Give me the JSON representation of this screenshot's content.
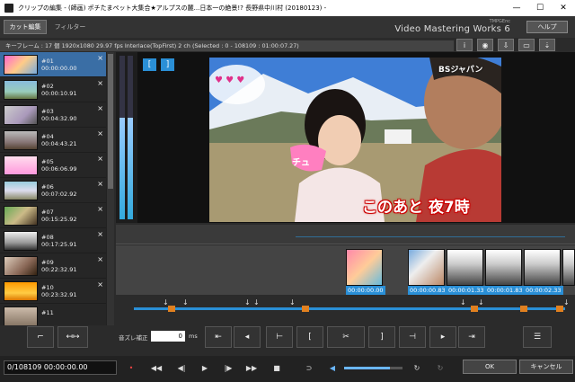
{
  "window": {
    "title": "クリップの編集 - (師画) ポチたまペット大集合★アルプスの麓...日本一の絶景!? 長野県中川村 (20180123) -",
    "minimize": "—",
    "maximize": "☐",
    "close": "✕"
  },
  "tabs": [
    {
      "label": "カット編集"
    },
    {
      "label": "フィルター"
    }
  ],
  "brand": {
    "small": "TMPGEnc",
    "name": "Video Mastering Works 6"
  },
  "help_label": "ヘルプ",
  "info_text": "キーフレーム : 17 個   1920x1080 29.97 fps  Interlace(TopFirst)  2 ch  (Selected : 0 - 108109 : 01:00:07.27)",
  "toolbar_icons": [
    {
      "name": "info-icon",
      "glyph": "i"
    },
    {
      "name": "audio-icon",
      "glyph": "◉"
    },
    {
      "name": "export-icon",
      "glyph": "⇩"
    },
    {
      "name": "screen-icon",
      "glyph": "▭"
    },
    {
      "name": "tool-icon",
      "glyph": "⇣"
    }
  ],
  "clips": [
    {
      "num": "#01",
      "time": "00:00:00.00"
    },
    {
      "num": "#02",
      "time": "00:00:10.91"
    },
    {
      "num": "#03",
      "time": "00:04:32.90"
    },
    {
      "num": "#04",
      "time": "00:04:43.21"
    },
    {
      "num": "#05",
      "time": "00:06:06.99"
    },
    {
      "num": "#06",
      "time": "00:07:02.92"
    },
    {
      "num": "#07",
      "time": "00:15:25.92"
    },
    {
      "num": "#08",
      "time": "00:17:25.91"
    },
    {
      "num": "#09",
      "time": "00:22:32.91"
    },
    {
      "num": "#10",
      "time": "00:23:32.91"
    },
    {
      "num": "#11",
      "time": ""
    }
  ],
  "clip_close_glyph": "×",
  "marker_in": "[",
  "marker_out": "]",
  "video_text": {
    "channel": "BSジャパン",
    "caption": "このあと 夜7時",
    "bubble": "チュ"
  },
  "timeline_times": [
    "00:00:00.00",
    "00:00:00.83",
    "00:00:01.33",
    "00:00:01.83",
    "00:00:02.33"
  ],
  "controls": {
    "offset_label": "音ズレ補正",
    "offset_value": "0",
    "offset_unit": "ms"
  },
  "bottom": {
    "timecode": "0/108109  00:00:00.00",
    "ok": "OK",
    "cancel": "キャンセル"
  },
  "audio_level_left": 0.62,
  "audio_level_right": 0.62,
  "volume_level": 0.78,
  "colors": {
    "accent": "#2a8fd6",
    "marker": "#e08020",
    "selected": "#3a6ea5"
  }
}
